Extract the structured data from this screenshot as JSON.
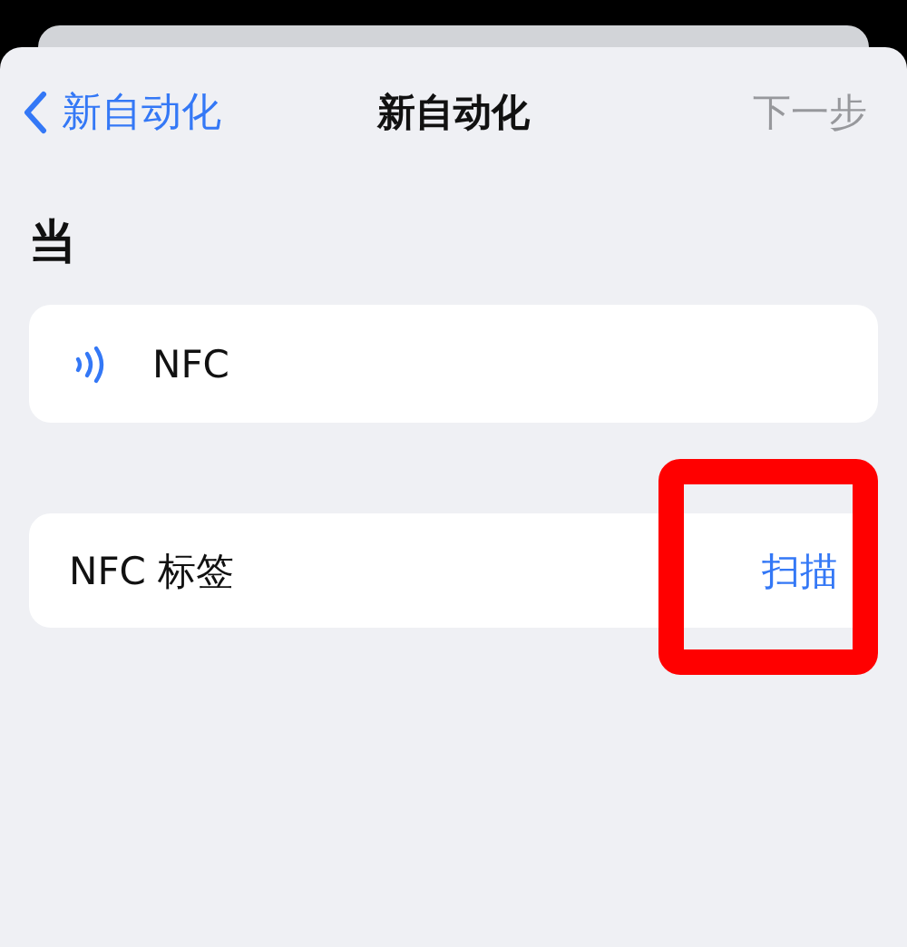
{
  "nav": {
    "back_label": "新自动化",
    "title": "新自动化",
    "next": {
      "label": "下一步",
      "disabled": true
    }
  },
  "section_title": "当",
  "trigger": {
    "label": "NFC"
  },
  "tag_row": {
    "label": "NFC 标签",
    "action": "扫描",
    "highlighted": true
  }
}
